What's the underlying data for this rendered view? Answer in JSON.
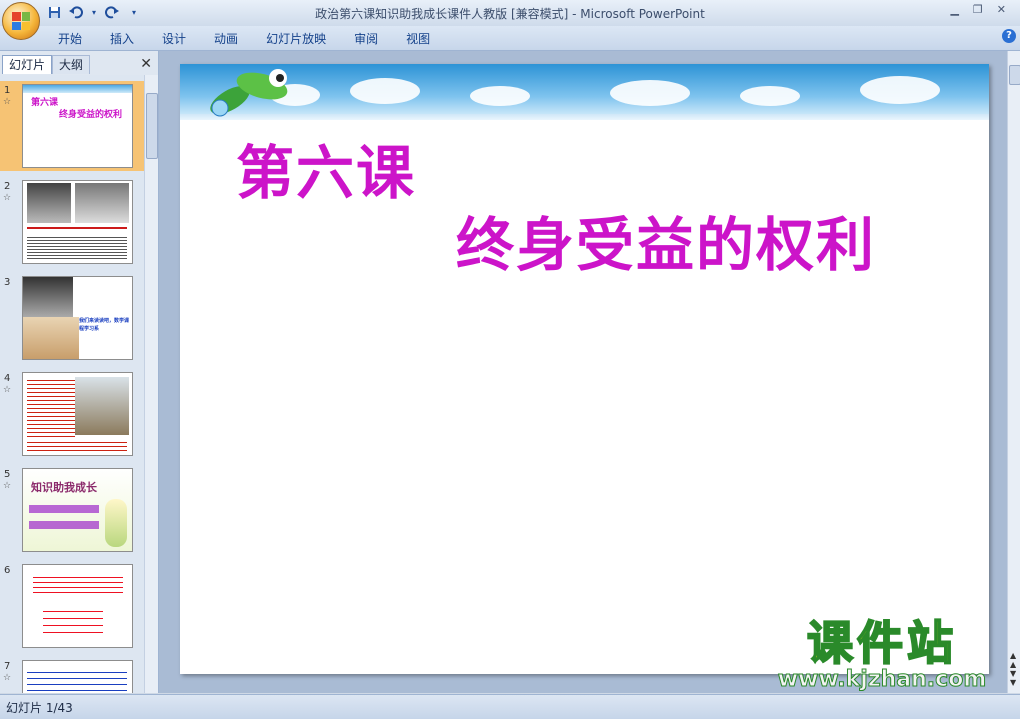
{
  "window": {
    "title": "政治第六课知识助我成长课件人教版 [兼容模式] - Microsoft PowerPoint",
    "controls": [
      "minimize-icon",
      "restore-icon",
      "close-icon"
    ]
  },
  "quick_access": [
    "save-icon",
    "undo-icon",
    "redo-icon",
    "customize-icon"
  ],
  "ribbon": {
    "tabs": [
      "开始",
      "插入",
      "设计",
      "动画",
      "幻灯片放映",
      "审阅",
      "视图"
    ],
    "help_label": "?"
  },
  "left_pane": {
    "tabs": [
      "幻灯片",
      "大纲"
    ],
    "close_label": "✕",
    "thumbnails": [
      {
        "num": "1",
        "anim": "☆",
        "title_line1": "第六课",
        "title_line2": "终身受益的权利"
      },
      {
        "num": "2",
        "anim": "☆"
      },
      {
        "num": "3",
        "anim": "☆",
        "caption": "我们来读读吧，数学课程学习系"
      },
      {
        "num": "4",
        "anim": "☆"
      },
      {
        "num": "5",
        "anim": "☆",
        "heading": "知识助我成长"
      },
      {
        "num": "6",
        "anim": "☆"
      },
      {
        "num": "7",
        "anim": "☆"
      }
    ]
  },
  "slide": {
    "title_line1": "第六课",
    "title_line2": "终身受益的权利",
    "title_color": "#cc14c9"
  },
  "status": {
    "slide_indicator": "幻灯片 1/43"
  },
  "watermark": {
    "text": "课件站",
    "url": "www.kjzhan.com"
  }
}
